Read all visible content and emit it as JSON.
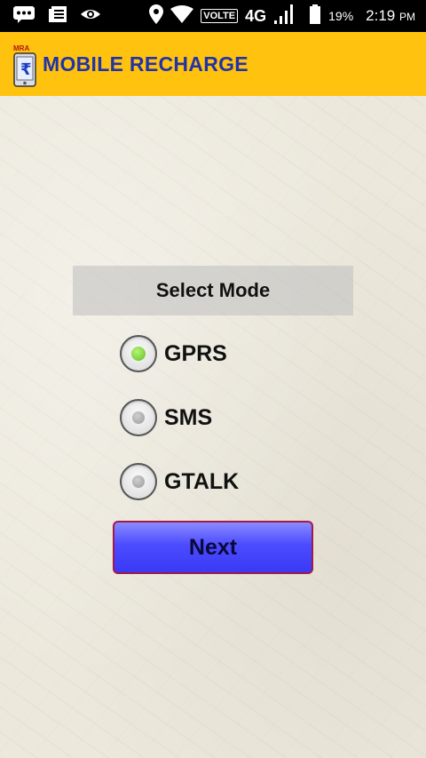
{
  "status_bar": {
    "network_label": "VOLTE",
    "network_type": "4G",
    "battery": "19%",
    "time": "2:19",
    "time_suffix": "PM"
  },
  "app": {
    "logo_text": "MRA",
    "title": "MOBILE RECHARGE"
  },
  "form": {
    "header": "Select Mode",
    "options": [
      {
        "label": "GPRS",
        "checked": true
      },
      {
        "label": "SMS",
        "checked": false
      },
      {
        "label": "GTALK",
        "checked": false
      }
    ],
    "next_label": "Next"
  },
  "colors": {
    "header_bg": "#ffc20e",
    "title": "#2233a8",
    "button": "#4b4bff",
    "radio_selected": "#5fc21d"
  },
  "icons": [
    "messages-icon",
    "notes-icon",
    "eye-icon",
    "location-icon",
    "wifi-icon",
    "signal-icon",
    "battery-icon",
    "recharge-logo-icon"
  ]
}
